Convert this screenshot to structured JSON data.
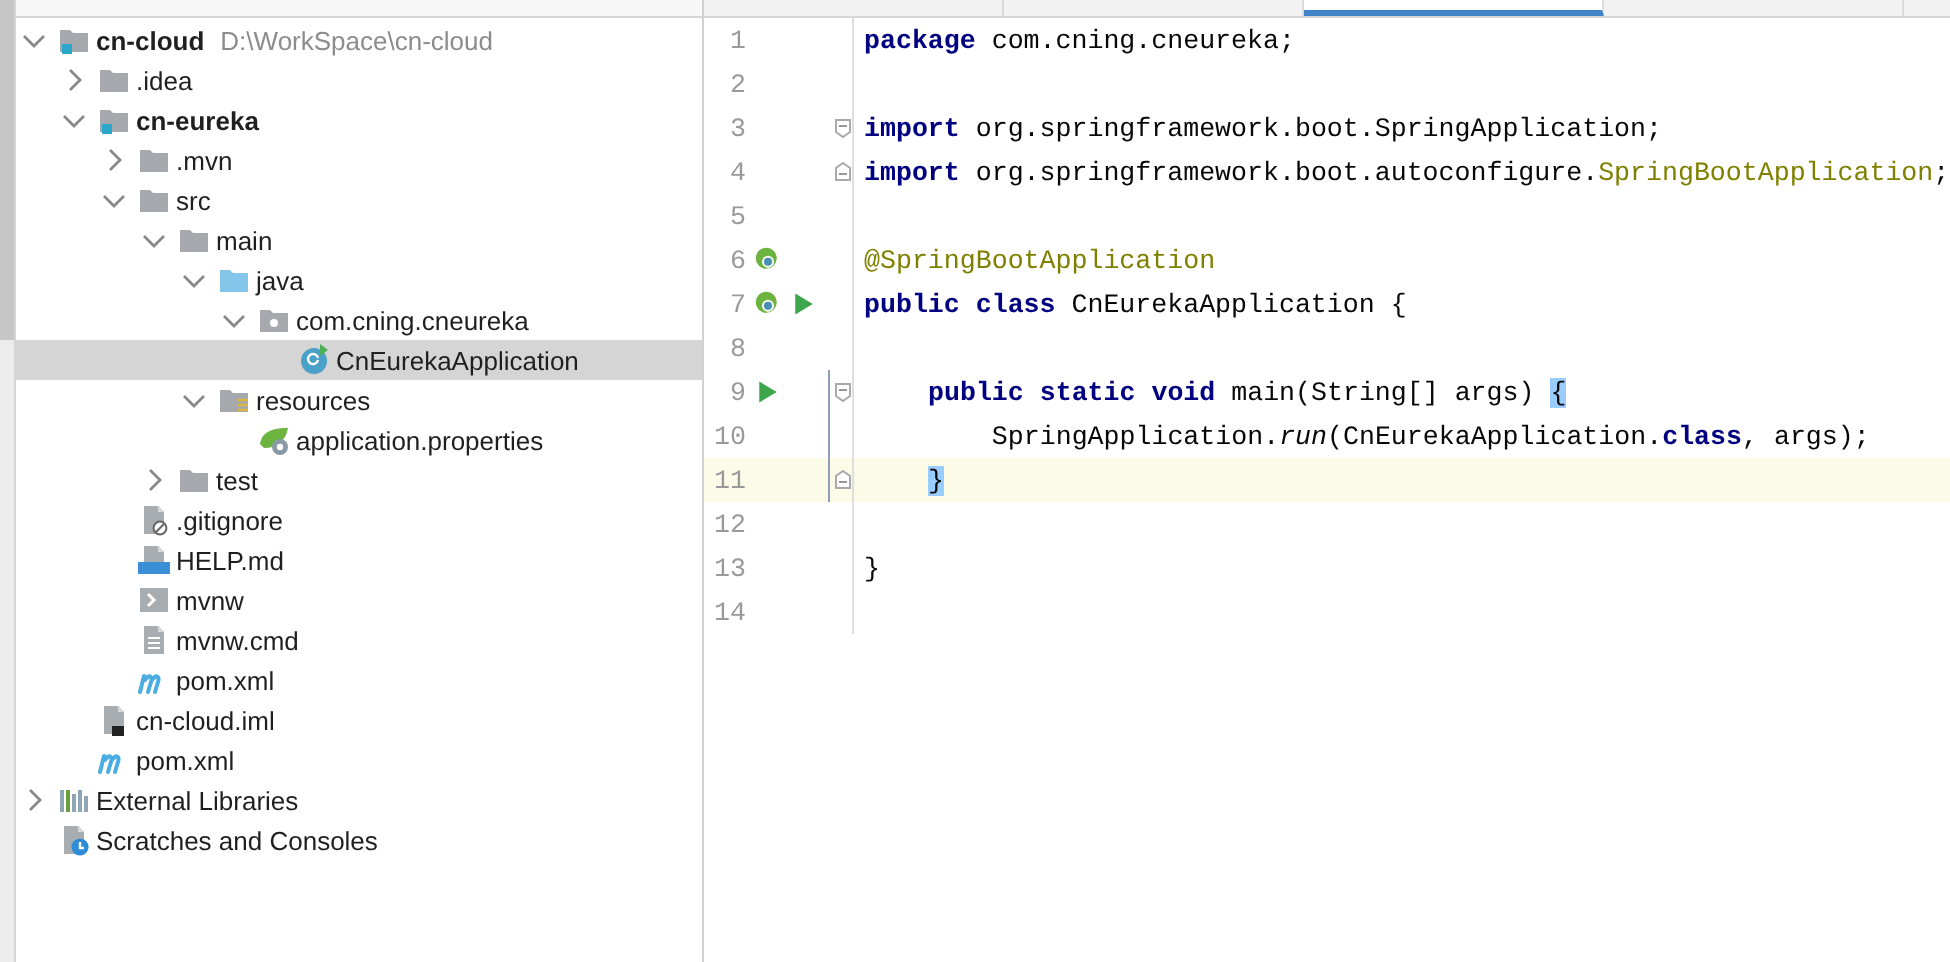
{
  "project": {
    "items": [
      {
        "label": "cn-cloud",
        "path": "D:\\WorkSpace\\cn-cloud",
        "kind": "module",
        "expanded": true,
        "selected": false,
        "children": [
          {
            "label": ".idea",
            "kind": "folder",
            "expanded": false,
            "selected": false
          },
          {
            "label": "cn-eureka",
            "kind": "module",
            "expanded": true,
            "selected": false,
            "children": [
              {
                "label": ".mvn",
                "kind": "folder",
                "expanded": false,
                "selected": false
              },
              {
                "label": "src",
                "kind": "folder",
                "expanded": true,
                "selected": false,
                "children": [
                  {
                    "label": "main",
                    "kind": "folder",
                    "expanded": true,
                    "selected": false,
                    "children": [
                      {
                        "label": "java",
                        "kind": "source-folder",
                        "expanded": true,
                        "selected": false,
                        "children": [
                          {
                            "label": "com.cning.cneureka",
                            "kind": "package",
                            "expanded": true,
                            "selected": false,
                            "children": [
                              {
                                "label": "CnEurekaApplication",
                                "kind": "class",
                                "selected": true
                              }
                            ]
                          }
                        ]
                      },
                      {
                        "label": "resources",
                        "kind": "resources-folder",
                        "expanded": true,
                        "selected": false,
                        "children": [
                          {
                            "label": "application.properties",
                            "kind": "spring-config",
                            "selected": false
                          }
                        ]
                      }
                    ]
                  },
                  {
                    "label": "test",
                    "kind": "folder",
                    "expanded": false,
                    "selected": false
                  }
                ]
              },
              {
                "label": ".gitignore",
                "kind": "ignore-file",
                "selected": false
              },
              {
                "label": "HELP.md",
                "kind": "markdown",
                "selected": false
              },
              {
                "label": "mvnw",
                "kind": "shell",
                "selected": false
              },
              {
                "label": "mvnw.cmd",
                "kind": "text-file",
                "selected": false
              },
              {
                "label": "pom.xml",
                "kind": "maven",
                "selected": false
              }
            ]
          },
          {
            "label": "cn-cloud.iml",
            "kind": "iml",
            "selected": false
          },
          {
            "label": "pom.xml",
            "kind": "maven",
            "selected": false
          }
        ]
      },
      {
        "label": "External Libraries",
        "kind": "libraries",
        "expanded": false,
        "selected": false
      },
      {
        "label": "Scratches and Consoles",
        "kind": "scratches",
        "selected": false
      }
    ]
  },
  "editor": {
    "tabs": [
      {
        "selected": false
      },
      {
        "selected": false
      },
      {
        "selected": true
      },
      {
        "selected": false
      }
    ],
    "lines": [
      {
        "number": "1",
        "current": false,
        "changed": false,
        "indented": false,
        "tokens": [
          {
            "text": "package",
            "kind": "keyword"
          },
          {
            "text": " com.cning.cneureka;",
            "kind": "plain"
          }
        ]
      },
      {
        "number": "2",
        "current": false,
        "changed": false
      },
      {
        "number": "3",
        "current": false,
        "changed": false,
        "indented": false,
        "fold": {
          "kind": "start"
        },
        "tokens": [
          {
            "text": "import",
            "kind": "keyword"
          },
          {
            "text": " org.springframework.boot.SpringApplication;",
            "kind": "plain"
          }
        ]
      },
      {
        "number": "4",
        "current": false,
        "changed": false,
        "indented": false,
        "fold": {
          "kind": "end"
        },
        "tokens": [
          {
            "text": "import",
            "kind": "keyword"
          },
          {
            "text": " org.springframework.boot.autoconfigure.",
            "kind": "plain"
          },
          {
            "text": "SpringBootApplication",
            "kind": "annotation"
          },
          {
            "text": ";",
            "kind": "plain"
          }
        ]
      },
      {
        "number": "5",
        "current": false,
        "changed": false
      },
      {
        "number": "6",
        "current": false,
        "changed": false,
        "indented": false,
        "markers": [
          {
            "kind": "bean"
          }
        ],
        "tokens": [
          {
            "text": "@SpringBootApplication",
            "kind": "annotation"
          }
        ]
      },
      {
        "number": "7",
        "current": false,
        "changed": false,
        "indented": false,
        "markers": [
          {
            "kind": "bean"
          },
          {
            "kind": "run"
          }
        ],
        "tokens": [
          {
            "text": "public class",
            "kind": "keyword"
          },
          {
            "text": " CnEurekaApplication {",
            "kind": "plain"
          }
        ]
      },
      {
        "number": "8",
        "current": false,
        "changed": false
      },
      {
        "number": "9",
        "current": false,
        "changed": true,
        "indented": true,
        "fold": {
          "kind": "start"
        },
        "markers": [
          {
            "kind": "run"
          }
        ],
        "tokens": [
          {
            "text": "public static void",
            "kind": "keyword"
          },
          {
            "text": " main(String[] args) ",
            "kind": "plain"
          },
          {
            "text": "{",
            "kind": "brace-match"
          }
        ]
      },
      {
        "number": "10",
        "current": false,
        "changed": true,
        "indented": true,
        "tokens": [
          {
            "text": "    SpringApplication.",
            "kind": "plain"
          },
          {
            "text": "run",
            "kind": "static-call"
          },
          {
            "text": "(CnEurekaApplication.",
            "kind": "plain"
          },
          {
            "text": "class",
            "kind": "keyword"
          },
          {
            "text": ", args);",
            "kind": "plain"
          }
        ]
      },
      {
        "number": "11",
        "current": true,
        "changed": true,
        "indented": true,
        "fold": {
          "kind": "end"
        },
        "tokens": [
          {
            "text": "}",
            "kind": "brace-match"
          }
        ]
      },
      {
        "number": "12",
        "current": false,
        "changed": false
      },
      {
        "number": "13",
        "current": false,
        "changed": false,
        "indented": false,
        "tokens": [
          {
            "text": "}",
            "kind": "plain"
          }
        ]
      },
      {
        "number": "14",
        "current": false,
        "changed": false
      }
    ]
  }
}
